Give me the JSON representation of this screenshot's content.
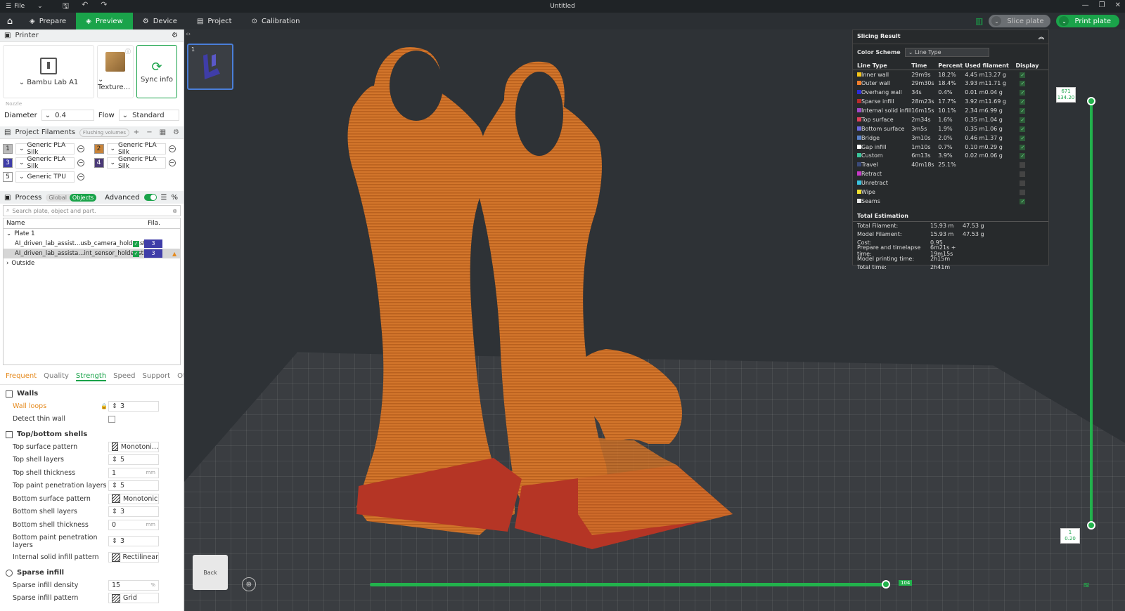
{
  "titlebar": {
    "menu_icon": "hamburger-icon",
    "file_label": "File",
    "title": "Untitled"
  },
  "topnav": {
    "tabs": [
      {
        "label": "Prepare",
        "icon": "prepare-icon",
        "active": false
      },
      {
        "label": "Preview",
        "icon": "preview-icon",
        "active": true
      },
      {
        "label": "Device",
        "icon": "device-icon",
        "active": false
      },
      {
        "label": "Project",
        "icon": "project-icon",
        "active": false
      },
      {
        "label": "Calibration",
        "icon": "calibration-icon",
        "active": false
      }
    ],
    "slice_label": "Slice plate",
    "print_label": "Print plate",
    "accent": "#1aa34a"
  },
  "printer": {
    "section_label": "Printer",
    "printer_name": "Bambu Lab A1",
    "plate_name": "Texture...",
    "sync_label": "Sync info",
    "nozzle_label": "Nozzle",
    "diameter_label": "Diameter",
    "diameter_value": "0.4",
    "flow_label": "Flow",
    "flow_value": "Standard"
  },
  "filaments": {
    "section_label": "Project Filaments",
    "flushing_label": "Flushing volumes",
    "items": [
      {
        "num": "1",
        "name": "Generic PLA Silk",
        "color": "#bcbcbc"
      },
      {
        "num": "2",
        "name": "Generic PLA Silk",
        "color": "#c8843a"
      },
      {
        "num": "3",
        "name": "Generic PLA Silk",
        "color": "#3f3da8"
      },
      {
        "num": "4",
        "name": "Generic PLA Silk",
        "color": "#4b3a78"
      },
      {
        "num": "5",
        "name": "Generic TPU",
        "color": "#ffffff"
      }
    ]
  },
  "process": {
    "section_label": "Process",
    "global_label": "Global",
    "objects_label": "Objects",
    "advanced_label": "Advanced",
    "search_placeholder": "Search plate, object and part.",
    "col_name": "Name",
    "col_fila": "Fila.",
    "plate_label": "Plate 1",
    "objects": [
      {
        "name": "AI_driven_lab_assist...usb_camera_holder.stl",
        "fila": "3",
        "selected": false
      },
      {
        "name": "AI_driven_lab_assista...int_sensor_holder.stl",
        "fila": "3",
        "selected": true
      }
    ],
    "outside_label": "Outside",
    "tabs": [
      "Frequent",
      "Quality",
      "Strength",
      "Speed",
      "Support",
      "Others"
    ],
    "active_tab": "Strength"
  },
  "settings": {
    "walls_title": "Walls",
    "wall_loops_label": "Wall loops",
    "wall_loops_value": "3",
    "detect_thin_label": "Detect thin wall",
    "shells_title": "Top/bottom shells",
    "top_pattern_label": "Top surface pattern",
    "top_pattern_value": "Monotoni...",
    "top_layers_label": "Top shell layers",
    "top_layers_value": "5",
    "top_thick_label": "Top shell thickness",
    "top_thick_value": "1",
    "top_paint_label": "Top paint penetration layers",
    "top_paint_value": "5",
    "bottom_pattern_label": "Bottom surface pattern",
    "bottom_pattern_value": "Monotonic",
    "bottom_layers_label": "Bottom shell layers",
    "bottom_layers_value": "3",
    "bottom_thick_label": "Bottom shell thickness",
    "bottom_thick_value": "0",
    "bottom_paint_label": "Bottom paint penetration layers",
    "bottom_paint_value": "3",
    "internal_pattern_label": "Internal solid infill pattern",
    "internal_pattern_value": "Rectilinear",
    "sparse_title": "Sparse infill",
    "sparse_density_label": "Sparse infill density",
    "sparse_density_value": "15",
    "sparse_pattern_label": "Sparse infill pattern",
    "sparse_pattern_value": "Grid",
    "unit_mm": "mm",
    "unit_pct": "%"
  },
  "viewport": {
    "plate_number": "1",
    "cube_label": "Back",
    "hslider_label": "104",
    "hslider_progress": 1.0,
    "vtop_label_a": "671",
    "vtop_label_b": "134.20",
    "vbottom_label_a": "1",
    "vbottom_label_b": "0.20"
  },
  "slicing": {
    "title": "Slicing Result",
    "color_scheme_label": "Color Scheme",
    "color_scheme_value": "Line Type",
    "headers": [
      "Line Type",
      "Time",
      "Percent",
      "Used filament",
      "Display"
    ],
    "rows": [
      {
        "name": "Inner wall",
        "time": "29m9s",
        "pct": "18.2%",
        "m": "4.45 m",
        "g": "13.27 g",
        "color": "#f5c518",
        "on": true
      },
      {
        "name": "Outer wall",
        "time": "29m30s",
        "pct": "18.4%",
        "m": "3.93 m",
        "g": "11.71 g",
        "color": "#f07d2b",
        "on": true
      },
      {
        "name": "Overhang wall",
        "time": "34s",
        "pct": "0.4%",
        "m": "0.01 m",
        "g": "0.04 g",
        "color": "#2b2bd8",
        "on": true
      },
      {
        "name": "Sparse infill",
        "time": "28m23s",
        "pct": "17.7%",
        "m": "3.92 m",
        "g": "11.69 g",
        "color": "#b82a2a",
        "on": true
      },
      {
        "name": "Internal solid infill",
        "time": "16m15s",
        "pct": "10.1%",
        "m": "2.34 m",
        "g": "6.99 g",
        "color": "#a048c8",
        "on": true
      },
      {
        "name": "Top surface",
        "time": "2m34s",
        "pct": "1.6%",
        "m": "0.35 m",
        "g": "1.04 g",
        "color": "#e0405a",
        "on": true
      },
      {
        "name": "Bottom surface",
        "time": "3m5s",
        "pct": "1.9%",
        "m": "0.35 m",
        "g": "1.06 g",
        "color": "#6a6ae0",
        "on": true
      },
      {
        "name": "Bridge",
        "time": "3m10s",
        "pct": "2.0%",
        "m": "0.46 m",
        "g": "1.37 g",
        "color": "#5b82c8",
        "on": true
      },
      {
        "name": "Gap infill",
        "time": "1m10s",
        "pct": "0.7%",
        "m": "0.10 m",
        "g": "0.29 g",
        "color": "#ffffff",
        "on": true
      },
      {
        "name": "Custom",
        "time": "6m13s",
        "pct": "3.9%",
        "m": "0.02 m",
        "g": "0.06 g",
        "color": "#3ac49a",
        "on": true
      },
      {
        "name": "Travel",
        "time": "40m18s",
        "pct": "25.1%",
        "m": "",
        "g": "",
        "color": "#3a4a7a",
        "on": false
      },
      {
        "name": "Retract",
        "time": "",
        "pct": "",
        "m": "",
        "g": "",
        "color": "#c838c8",
        "on": false
      },
      {
        "name": "Unretract",
        "time": "",
        "pct": "",
        "m": "",
        "g": "",
        "color": "#3ac4e0",
        "on": false
      },
      {
        "name": "Wipe",
        "time": "",
        "pct": "",
        "m": "",
        "g": "",
        "color": "#f0e030",
        "on": false
      },
      {
        "name": "Seams",
        "time": "",
        "pct": "",
        "m": "",
        "g": "",
        "color": "#e8e8e8",
        "on": true
      }
    ],
    "total_title": "Total Estimation",
    "totals": [
      {
        "k": "Total Filament:",
        "v1": "15.93 m",
        "v2": "47.53 g"
      },
      {
        "k": "Model Filament:",
        "v1": "15.93 m",
        "v2": "47.53 g"
      },
      {
        "k": "Cost:",
        "v1": "0.95",
        "v2": ""
      },
      {
        "k": "Prepare and timelapse time:",
        "v1": "6m21s + 19m15s",
        "v2": ""
      },
      {
        "k": "Model printing time:",
        "v1": "2h15m",
        "v2": ""
      },
      {
        "k": "Total time:",
        "v1": "2h41m",
        "v2": ""
      }
    ]
  }
}
